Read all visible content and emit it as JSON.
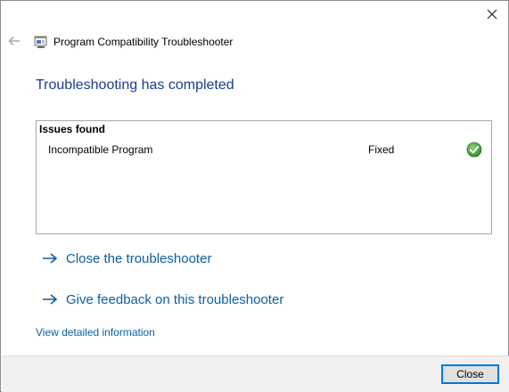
{
  "window": {
    "title": "Program Compatibility Troubleshooter",
    "close_glyph": "✕",
    "back_glyph": "←"
  },
  "main": {
    "heading": "Troubleshooting has completed",
    "issues": {
      "header": "Issues found",
      "rows": [
        {
          "name": "Incompatible Program",
          "status": "Fixed",
          "status_icon": "green-check-icon"
        }
      ]
    },
    "links": [
      {
        "label": "Close the troubleshooter"
      },
      {
        "label": "Give feedback on this troubleshooter"
      }
    ],
    "detail_link": "View detailed information"
  },
  "footer": {
    "close_label": "Close"
  },
  "colors": {
    "heading": "#1a3d8f",
    "link": "#0b5fa5",
    "check_green": "#3c9a2e",
    "footer_bg": "#f0f0f0",
    "button_border": "#0078d7"
  }
}
